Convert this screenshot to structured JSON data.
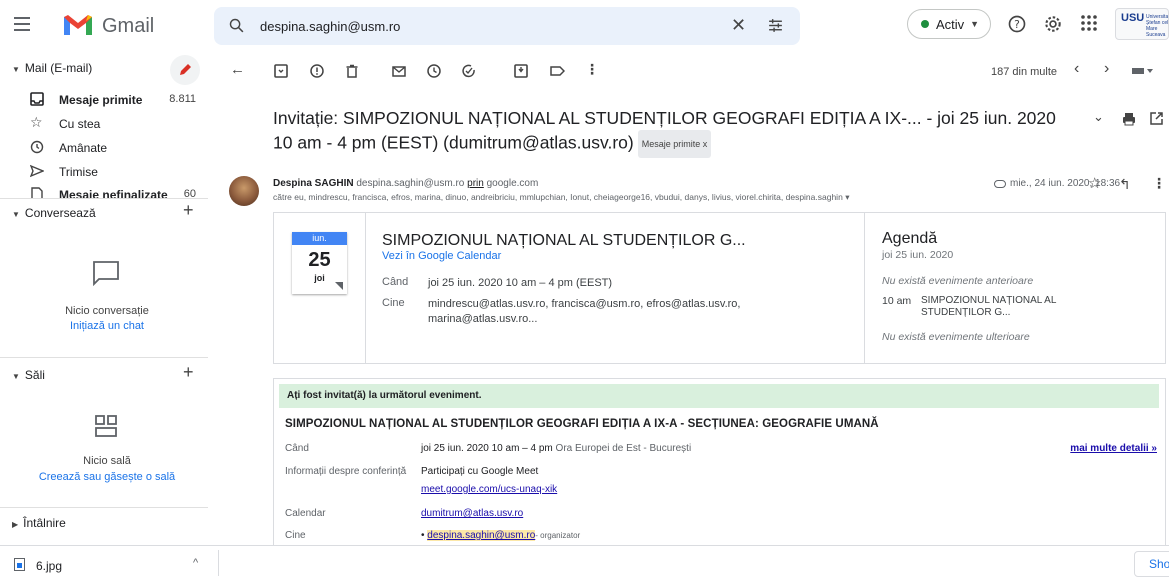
{
  "app": {
    "name": "Gmail"
  },
  "search": {
    "value": "despina.saghin@usm.ro"
  },
  "status": {
    "label": "Activ"
  },
  "org_logo": {
    "mark": "USU",
    "text": "Universitatea Ștefan cel Mare Suceava"
  },
  "sidebar": {
    "mail_header": "Mail (E-mail)",
    "items": [
      {
        "label": "Mesaje primite",
        "count": "8.811",
        "icon": "inbox-icon"
      },
      {
        "label": "Cu stea",
        "count": "",
        "icon": "star-icon"
      },
      {
        "label": "Amânate",
        "count": "",
        "icon": "clock-icon"
      },
      {
        "label": "Trimise",
        "count": "",
        "icon": "send-icon"
      },
      {
        "label": "Mesaje nefinalizate",
        "count": "60",
        "icon": "draft-icon"
      }
    ],
    "chat_header": "Conversează",
    "chat_empty": "Nicio conversație",
    "chat_link": "Inițiază un chat",
    "rooms_header": "Săli",
    "rooms_empty": "Nicio sală",
    "rooms_link": "Creează sau găsește o sală",
    "meet_header": "Întâlnire"
  },
  "toolbar": {
    "count": "187 din multe"
  },
  "email": {
    "subject": "Invitație: SIMPOZIONUL NAȚIONAL AL STUDENȚILOR GEOGRAFI EDIȚIA A IX-... - joi 25 iun. 2020 10 am - 4 pm (EEST) (dumitrum@atlas.usv.ro)",
    "label_chip": "Mesaje primite",
    "sender_name": "Despina SAGHIN",
    "sender_email": "despina.saghin@usm.ro",
    "via": "prin",
    "via_domain": "google.com",
    "recipients": "către eu, mindrescu, francisca, efros, marina, dinuo, andreibriciu, mmlupchian, Ionut, cheiageorge16, vbudui, danys, livius, viorel.chirita, despina.saghin",
    "date": "mie., 24 iun. 2020, 18:36"
  },
  "invite": {
    "month": "iun.",
    "day": "25",
    "dow": "joi",
    "title": "SIMPOZIONUL NAȚIONAL AL STUDENȚILOR G...",
    "view_link": "Vezi în Google Calendar",
    "when_label": "Când",
    "when_value": "joi 25 iun. 2020 10 am – 4 pm (EEST)",
    "who_label": "Cine",
    "who_value_1": "mindrescu@atlas.usv.ro, francisca@usm.ro, efros@atlas.usv.ro,",
    "who_value_2": "marina@atlas.usv.ro..."
  },
  "agenda": {
    "title": "Agendă",
    "date": "joi 25 iun. 2020",
    "no_prev": "Nu există evenimente anterioare",
    "event_time": "10 am",
    "event_title": "SIMPOZIONUL NAȚIONAL AL STUDENȚILOR G...",
    "no_next": "Nu există evenimente ulterioare"
  },
  "details": {
    "banner": "Ați fost invitat(ă) la următorul eveniment.",
    "title": "SIMPOZIONUL NAȚIONAL AL STUDENȚILOR GEOGRAFI EDIȚIA A IX-A - SECȚIUNEA: GEOGRAFIE UMANĂ",
    "when_label": "Când",
    "when_value": "joi 25 iun. 2020 10 am – 4 pm",
    "when_tz": "Ora Europei de Est - București",
    "more_link": "mai multe detalii »",
    "conf_label": "Informații despre conferință",
    "conf_value": "Participați cu Google Meet",
    "meet_link": "meet.google.com/ucs-unaq-xik",
    "cal_label": "Calendar",
    "cal_value": "dumitrum@atlas.usv.ro",
    "who_label": "Cine",
    "who_value": "despina.saghin@usm.ro",
    "who_role": "- organizator"
  },
  "downloads": {
    "file": "6.jpg",
    "show_all": "Sho"
  }
}
